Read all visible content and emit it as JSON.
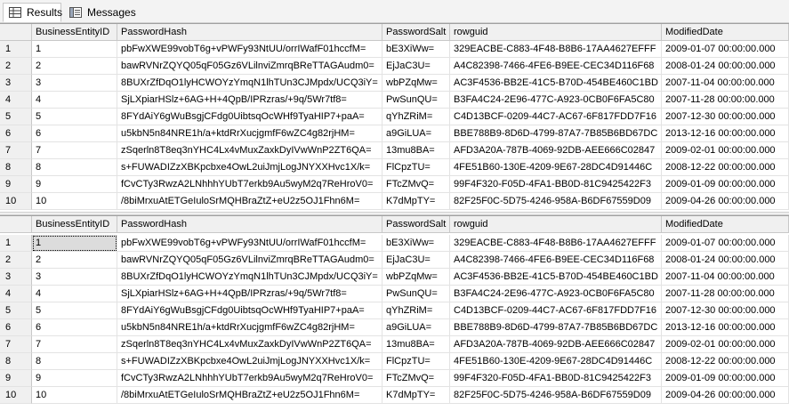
{
  "tabs": [
    {
      "label": "Results",
      "icon": "grid-icon",
      "active": true
    },
    {
      "label": "Messages",
      "icon": "messages-icon",
      "active": false
    }
  ],
  "columns": [
    "",
    "BusinessEntityID",
    "PasswordHash",
    "PasswordSalt",
    "rowguid",
    "ModifiedDate"
  ],
  "rows": [
    [
      "1",
      "1",
      "pbFwXWE99vobT6g+vPWFy93NtUU/orrIWafF01hccfM=",
      "bE3XiWw=",
      "329EACBE-C883-4F48-B8B6-17AA4627EFFF",
      "2009-01-07 00:00:00.000"
    ],
    [
      "2",
      "2",
      "bawRVNrZQYQ05qF05Gz6VLilnviZmrqBReTTAGAudm0=",
      "EjJaC3U=",
      "A4C82398-7466-4FE6-B9EE-CEC34D116F68",
      "2008-01-24 00:00:00.000"
    ],
    [
      "3",
      "3",
      "8BUXrZfDqO1lyHCWOYzYmqN1lhTUn3CJMpdx/UCQ3iY=",
      "wbPZqMw=",
      "AC3F4536-BB2E-41C5-B70D-454BE460C1BD",
      "2007-11-04 00:00:00.000"
    ],
    [
      "4",
      "4",
      "SjLXpiarHSlz+6AG+H+4QpB/IPRzras/+9q/5Wr7tf8=",
      "PwSunQU=",
      "B3FA4C24-2E96-477C-A923-0CB0F6FA5C80",
      "2007-11-28 00:00:00.000"
    ],
    [
      "5",
      "5",
      "8FYdAiY6gWuBsgjCFdg0UibtsqOcWHf9TyaHIP7+paA=",
      "qYhZRiM=",
      "C4D13BCF-0209-44C7-AC67-6F817FDD7F16",
      "2007-12-30 00:00:00.000"
    ],
    [
      "6",
      "6",
      "u5kbN5n84NRE1h/a+ktdRrXucjgmfF6wZC4g82rjHM=",
      "a9GiLUA=",
      "BBE788B9-8D6D-4799-87A7-7B85B6BD67DC",
      "2013-12-16 00:00:00.000"
    ],
    [
      "7",
      "7",
      "zSqerln8T8eq3nYHC4Lx4vMuxZaxkDyIVwWnP2ZT6QA=",
      "13mu8BA=",
      "AFD3A20A-787B-4069-92DB-AEE666C02847",
      "2009-02-01 00:00:00.000"
    ],
    [
      "8",
      "8",
      "s+FUWADIZzXBKpcbxe4OwL2uiJmjLogJNYXXHvc1X/k=",
      "FlCpzTU=",
      "4FE51B60-130E-4209-9E67-28DC4D91446C",
      "2008-12-22 00:00:00.000"
    ],
    [
      "9",
      "9",
      "fCvCTy3RwzA2LNhhhYUbT7erkb9Au5wyM2q7ReHroV0=",
      "FTcZMvQ=",
      "99F4F320-F05D-4FA1-BB0D-81C9425422F3",
      "2009-01-09 00:00:00.000"
    ],
    [
      "10",
      "10",
      "/8biMrxuAtETGeIuloSrMQHBraZtZ+eU2z5OJ1Fhn6M=",
      "K7dMpTY=",
      "82F25F0C-5D75-4246-958A-B6DF67559D09",
      "2009-04-26 00:00:00.000"
    ]
  ]
}
